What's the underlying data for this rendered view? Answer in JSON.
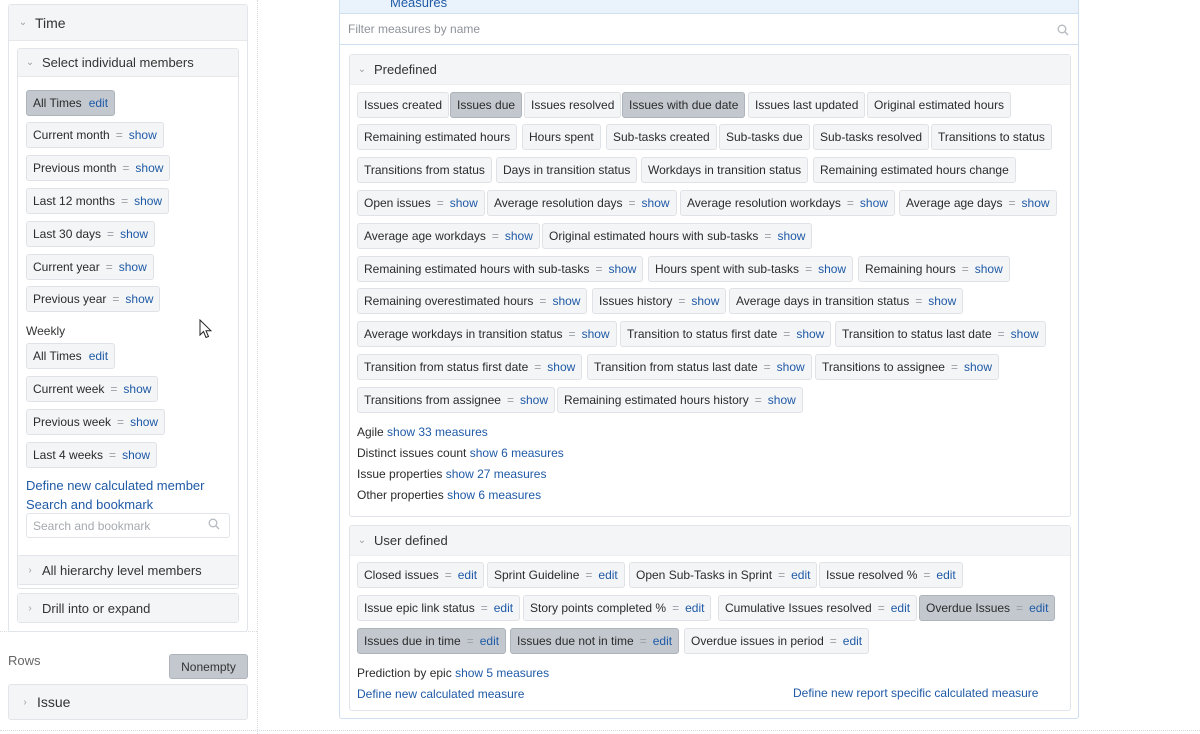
{
  "left": {
    "time_title": "Time",
    "select_members_title": "Select individual members",
    "all_times": "All Times",
    "edit": "edit",
    "show": "show",
    "eq": "=",
    "current_month": "Current month",
    "previous_month": "Previous month",
    "last_12_months": "Last 12 months",
    "last_30_days": "Last 30 days",
    "current_year": "Current year",
    "previous_year": "Previous year",
    "weekly_label": "Weekly",
    "weekly_all_times": "All Times",
    "current_week": "Current week",
    "previous_week": "Previous week",
    "last_4_weeks": "Last 4 weeks",
    "define_member_link": "Define new calculated member",
    "search_bookmark_link": "Search and bookmark",
    "search_placeholder": "Search and bookmark",
    "hierarchy_title": "All hierarchy level members",
    "drill_title": "Drill into or expand",
    "rows_label": "Rows",
    "nonempty_label": "Nonempty",
    "issue_row": "Issue"
  },
  "measures": {
    "header_title": "Measures",
    "filter_placeholder": "Filter measures by name",
    "predefined_title": "Predefined",
    "predefined": {
      "issues_created": "Issues created",
      "issues_due": "Issues due",
      "issues_resolved": "Issues resolved",
      "issues_with_due_date": "Issues with due date",
      "issues_last_updated": "Issues last updated",
      "original_estimated_hours": "Original estimated hours",
      "remaining_estimated_hours": "Remaining estimated hours",
      "hours_spent": "Hours spent",
      "subtasks_created": "Sub-tasks created",
      "subtasks_due": "Sub-tasks due",
      "subtasks_resolved": "Sub-tasks resolved",
      "transitions_to_status": "Transitions to status",
      "transitions_from_status": "Transitions from status",
      "days_in_transition_status": "Days in transition status",
      "workdays_in_transition_status": "Workdays in transition status",
      "remaining_estimated_hours_change": "Remaining estimated hours change",
      "open_issues": "Open issues",
      "average_resolution_days": "Average resolution days",
      "average_resolution_workdays": "Average resolution workdays",
      "average_age_days": "Average age days",
      "average_age_workdays": "Average age workdays",
      "original_estimated_hours_with_subtasks": "Original estimated hours with sub-tasks",
      "remaining_estimated_hours_with_subtasks": "Remaining estimated hours with sub-tasks",
      "hours_spent_with_subtasks": "Hours spent with sub-tasks",
      "remaining_hours": "Remaining hours",
      "remaining_overestimated_hours": "Remaining overestimated hours",
      "issues_history": "Issues history",
      "average_days_in_transition_status": "Average days in transition status",
      "average_workdays_in_transition_status": "Average workdays in transition status",
      "transition_to_status_first_date": "Transition to status first date",
      "transition_to_status_last_date": "Transition to status last date",
      "transition_from_status_first_date": "Transition from status first date",
      "transition_from_status_last_date": "Transition from status last date",
      "transitions_to_assignee": "Transitions to assignee",
      "transitions_from_assignee": "Transitions from assignee",
      "remaining_estimated_hours_history": "Remaining estimated hours history"
    },
    "groups": {
      "agile_label": "Agile",
      "agile_link": "show 33 measures",
      "distinct_label": "Distinct issues count",
      "distinct_link": "show 6 measures",
      "issue_props_label": "Issue properties",
      "issue_props_link": "show 27 measures",
      "other_props_label": "Other properties",
      "other_props_link": "show 6 measures"
    },
    "user_defined_title": "User defined",
    "user": {
      "closed_issues": "Closed issues",
      "sprint_guideline": "Sprint Guideline",
      "open_subtasks_in_sprint": "Open Sub-Tasks in Sprint",
      "issue_resolved_pct": "Issue resolved %",
      "issue_epic_link_status": "Issue epic link status",
      "story_points_completed_pct": "Story points completed %",
      "cumulative_issues_resolved": "Cumulative Issues resolved",
      "overdue_issues": "Overdue Issues",
      "issues_due_in_time": "Issues due in time",
      "issues_due_not_in_time": "Issues due not in time",
      "overdue_issues_in_period": "Overdue issues in period"
    },
    "prediction_label": "Prediction by epic",
    "prediction_link": "show 5 measures",
    "define_measure_link": "Define new calculated measure",
    "define_report_measure_link": "Define new report specific calculated measure"
  }
}
